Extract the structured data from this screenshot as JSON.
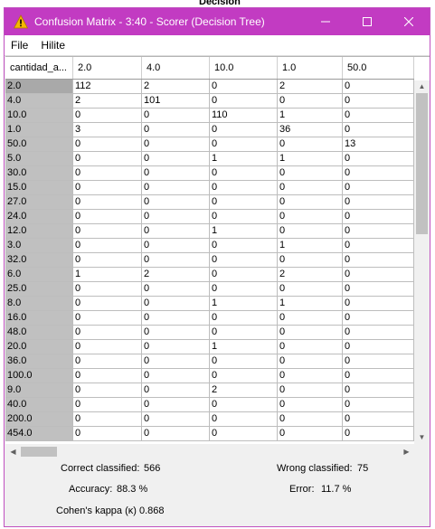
{
  "background": {
    "top_label": "Decision"
  },
  "window": {
    "title": "Confusion Matrix - 3:40 - Scorer (Decision Tree)",
    "accent": "#c23bc2"
  },
  "menu": {
    "items": [
      "File",
      "Hilite"
    ]
  },
  "table": {
    "corner_header": "cantidad_a...",
    "columns": [
      "2.0",
      "4.0",
      "10.0",
      "1.0",
      "50.0"
    ],
    "rows": [
      {
        "label": "2.0",
        "cells": [
          "112",
          "2",
          "0",
          "2",
          "0"
        ]
      },
      {
        "label": "4.0",
        "cells": [
          "2",
          "101",
          "0",
          "0",
          "0"
        ]
      },
      {
        "label": "10.0",
        "cells": [
          "0",
          "0",
          "110",
          "1",
          "0"
        ]
      },
      {
        "label": "1.0",
        "cells": [
          "3",
          "0",
          "0",
          "36",
          "0"
        ]
      },
      {
        "label": "50.0",
        "cells": [
          "0",
          "0",
          "0",
          "0",
          "13"
        ]
      },
      {
        "label": "5.0",
        "cells": [
          "0",
          "0",
          "1",
          "1",
          "0"
        ]
      },
      {
        "label": "30.0",
        "cells": [
          "0",
          "0",
          "0",
          "0",
          "0"
        ]
      },
      {
        "label": "15.0",
        "cells": [
          "0",
          "0",
          "0",
          "0",
          "0"
        ]
      },
      {
        "label": "27.0",
        "cells": [
          "0",
          "0",
          "0",
          "0",
          "0"
        ]
      },
      {
        "label": "24.0",
        "cells": [
          "0",
          "0",
          "0",
          "0",
          "0"
        ]
      },
      {
        "label": "12.0",
        "cells": [
          "0",
          "0",
          "1",
          "0",
          "0"
        ]
      },
      {
        "label": "3.0",
        "cells": [
          "0",
          "0",
          "0",
          "1",
          "0"
        ]
      },
      {
        "label": "32.0",
        "cells": [
          "0",
          "0",
          "0",
          "0",
          "0"
        ]
      },
      {
        "label": "6.0",
        "cells": [
          "1",
          "2",
          "0",
          "2",
          "0"
        ]
      },
      {
        "label": "25.0",
        "cells": [
          "0",
          "0",
          "0",
          "0",
          "0"
        ]
      },
      {
        "label": "8.0",
        "cells": [
          "0",
          "0",
          "1",
          "1",
          "0"
        ]
      },
      {
        "label": "16.0",
        "cells": [
          "0",
          "0",
          "0",
          "0",
          "0"
        ]
      },
      {
        "label": "48.0",
        "cells": [
          "0",
          "0",
          "0",
          "0",
          "0"
        ]
      },
      {
        "label": "20.0",
        "cells": [
          "0",
          "0",
          "1",
          "0",
          "0"
        ]
      },
      {
        "label": "36.0",
        "cells": [
          "0",
          "0",
          "0",
          "0",
          "0"
        ]
      },
      {
        "label": "100.0",
        "cells": [
          "0",
          "0",
          "0",
          "0",
          "0"
        ]
      },
      {
        "label": "9.0",
        "cells": [
          "0",
          "0",
          "2",
          "0",
          "0"
        ]
      },
      {
        "label": "40.0",
        "cells": [
          "0",
          "0",
          "0",
          "0",
          "0"
        ]
      },
      {
        "label": "200.0",
        "cells": [
          "0",
          "0",
          "0",
          "0",
          "0"
        ]
      },
      {
        "label": "454.0",
        "cells": [
          "0",
          "0",
          "0",
          "0",
          "0"
        ]
      }
    ]
  },
  "stats": {
    "correct_label": "Correct classified:",
    "correct_value": "566",
    "wrong_label": "Wrong classified:",
    "wrong_value": "75",
    "accuracy_label": "Accuracy:",
    "accuracy_value": "88.3 %",
    "error_label": "Error:",
    "error_value": "11.7 %",
    "kappa_label": "Cohen's kappa (κ)",
    "kappa_value": "0.868"
  }
}
